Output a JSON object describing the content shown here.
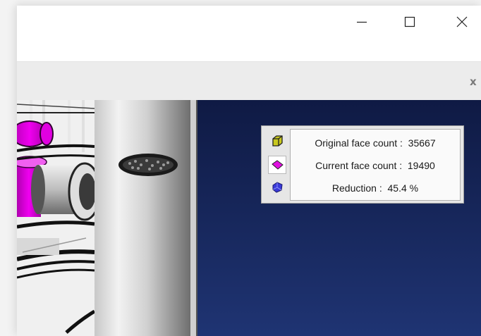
{
  "window": {
    "controls": [
      "minimize-icon",
      "maximize-icon",
      "close-icon"
    ]
  },
  "toolbar": {
    "close_label": "x"
  },
  "info_panel": {
    "rows": [
      {
        "label": "Original face count :",
        "value": "35667",
        "icon": "box-icon"
      },
      {
        "label": "Current face count :",
        "value": "19490",
        "icon": "face-icon"
      },
      {
        "label": "Reduction :",
        "value": "45.4 %",
        "icon": "solid-icon"
      }
    ]
  },
  "colors": {
    "viewport_top": "#0f1a44",
    "viewport_bottom": "#1f3473",
    "highlight_magenta": "#e000e0"
  }
}
